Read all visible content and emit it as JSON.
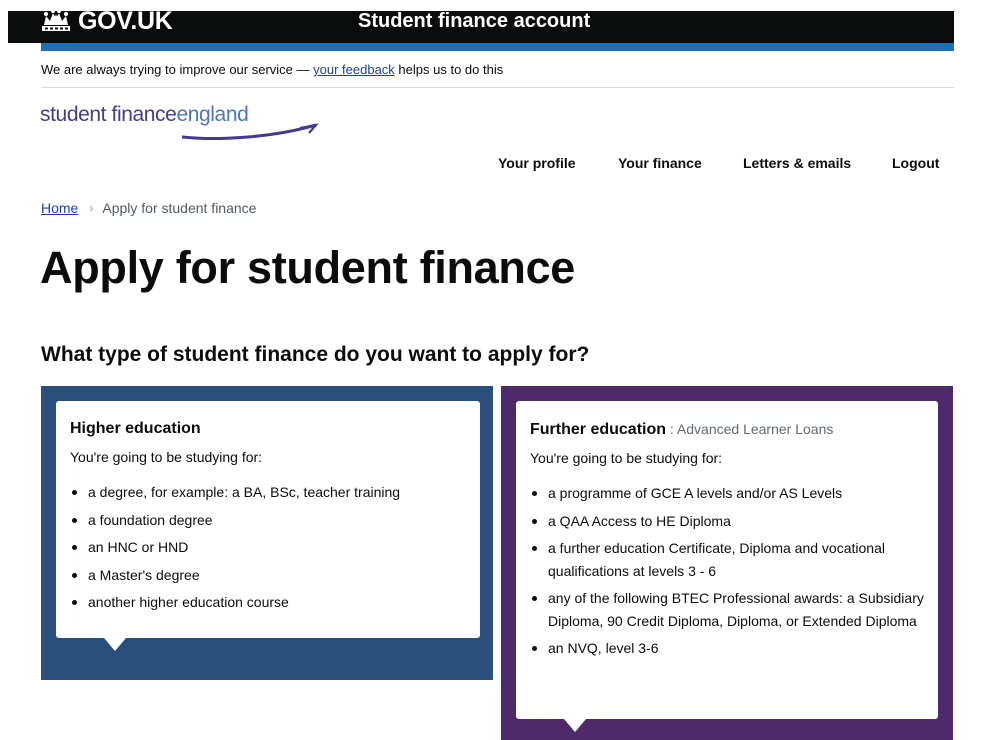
{
  "header": {
    "logo_text": "GOV.UK",
    "service_name": "Student finance account"
  },
  "feedback": {
    "before": "We are always trying to improve our service — ",
    "link": "your feedback",
    "after": " helps us to do this"
  },
  "logo": {
    "part1": "student finance",
    "part2": "england"
  },
  "nav": {
    "items": [
      {
        "label": "Your profile"
      },
      {
        "label": "Your finance"
      },
      {
        "label": "Letters & emails"
      },
      {
        "label": "Logout"
      }
    ]
  },
  "breadcrumb": {
    "home": "Home",
    "separator": "›",
    "current": "Apply for student finance"
  },
  "page": {
    "title": "Apply for student finance",
    "question": "What type of student finance do you want to apply for?"
  },
  "options": {
    "higher": {
      "title": "Higher education",
      "lead": "You're going to be studying for:",
      "items": [
        "a degree, for example: a BA, BSc, teacher training",
        "a foundation degree",
        "an HNC or HND",
        "a Master's degree",
        "another higher education course"
      ]
    },
    "further": {
      "title": "Further education",
      "subtitle": " : Advanced Learner Loans",
      "lead": "You're going to be studying for:",
      "items": [
        "a programme of GCE A levels and/or AS Levels",
        "a QAA Access to HE Diploma",
        "a further education Certificate, Diploma and vocational qualifications at levels 3 - 6",
        "any of the following BTEC Professional awards: a Subsidiary Diploma, 90 Credit Diploma, Diploma, or Extended Diploma",
        "an NVQ, level 3-6"
      ]
    }
  },
  "colors": {
    "header_bg": "#0b0c0c",
    "header_accent": "#1d70b8",
    "link": "#1d3fa0",
    "higher_panel": "#2a4f7a",
    "further_panel": "#4f2a6b"
  }
}
